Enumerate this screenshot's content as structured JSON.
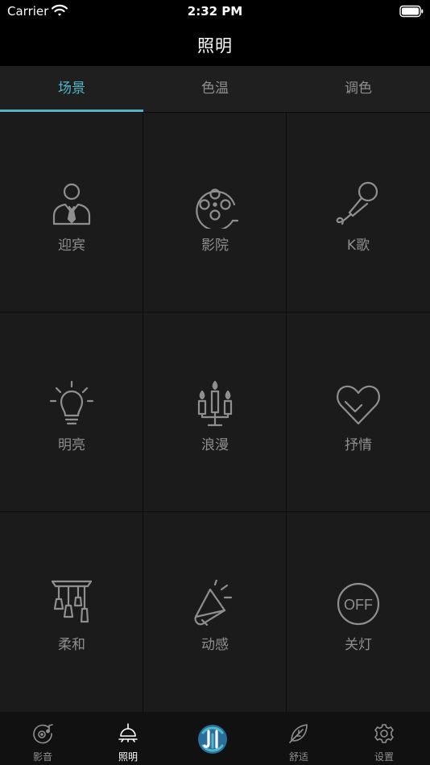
{
  "status": {
    "carrier": "Carrier",
    "time": "2:32 PM"
  },
  "nav": {
    "title": "照明"
  },
  "tabs": [
    {
      "label": "场景"
    },
    {
      "label": "色温"
    },
    {
      "label": "调色"
    }
  ],
  "scenes": [
    {
      "label": "迎宾",
      "icon": "host-icon"
    },
    {
      "label": "影院",
      "icon": "film-reel-icon"
    },
    {
      "label": "K歌",
      "icon": "microphone-icon"
    },
    {
      "label": "明亮",
      "icon": "bulb-icon"
    },
    {
      "label": "浪漫",
      "icon": "candles-icon"
    },
    {
      "label": "抒情",
      "icon": "heart-icon"
    },
    {
      "label": "柔和",
      "icon": "pendant-lamps-icon"
    },
    {
      "label": "动感",
      "icon": "megaphone-icon"
    },
    {
      "label": "关灯",
      "icon": "off-icon"
    }
  ],
  "off_text": "OFF",
  "bottom_tabs": [
    {
      "label": "影音",
      "icon": "music-disc-icon"
    },
    {
      "label": "照明",
      "icon": "ceiling-light-icon"
    },
    {
      "label": "",
      "icon": "app-logo-icon"
    },
    {
      "label": "舒适",
      "icon": "leaf-icon"
    },
    {
      "label": "设置",
      "icon": "gear-icon"
    }
  ],
  "colors": {
    "accent": "#4fb7c8",
    "icon": "#8f8f8f",
    "background": "#1b1b1b",
    "logo_dark": "#2a6f9b"
  }
}
